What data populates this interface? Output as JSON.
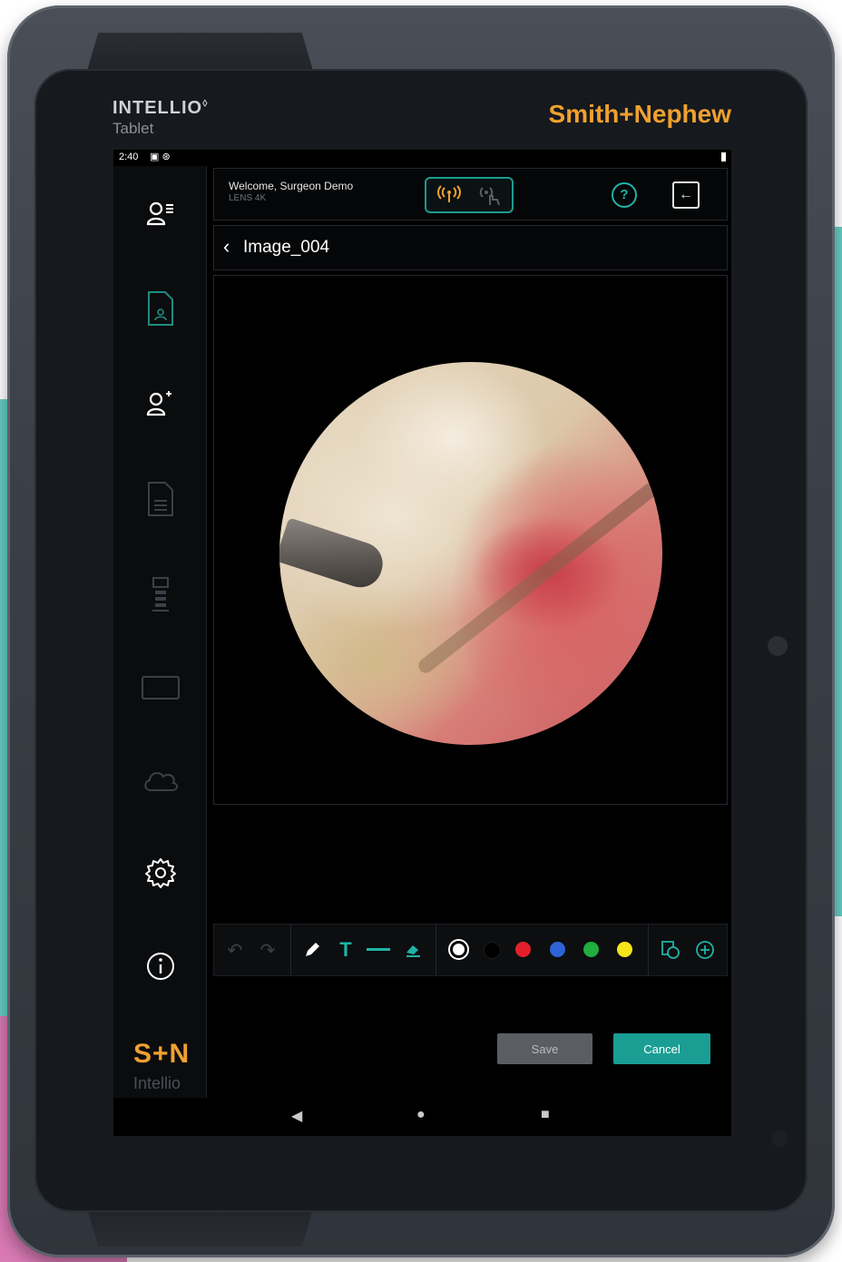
{
  "device": {
    "brand_product": "INTELLIO",
    "brand_product_mark": "◊",
    "brand_sub": "Tablet",
    "brand_company": "Smith+Nephew"
  },
  "status_bar": {
    "time": "2:40"
  },
  "sidebar": {
    "items": [
      {
        "name": "user-list",
        "icon": "user-list-icon",
        "state": "active"
      },
      {
        "name": "patient-file",
        "icon": "patient-file-icon",
        "state": "selected"
      },
      {
        "name": "add-user",
        "icon": "add-user-icon",
        "state": "active"
      },
      {
        "name": "document",
        "icon": "document-icon",
        "state": "disabled"
      },
      {
        "name": "tower",
        "icon": "tower-icon",
        "state": "disabled"
      },
      {
        "name": "display",
        "icon": "display-icon",
        "state": "disabled"
      },
      {
        "name": "cloud",
        "icon": "cloud-icon",
        "state": "disabled"
      },
      {
        "name": "settings",
        "icon": "gear-icon",
        "state": "active"
      },
      {
        "name": "info",
        "icon": "info-icon",
        "state": "active"
      }
    ],
    "logo": "S+N",
    "logo_sub": "Intellio"
  },
  "header": {
    "welcome": "Welcome, Surgeon Demo",
    "device_name": "LENS 4K",
    "help_label": "?",
    "colors": {
      "accent": "#1fb3a6",
      "signal": "#f0a030"
    }
  },
  "image_view": {
    "title": "Image_004"
  },
  "annotation_toolbar": {
    "tools": [
      "undo-icon",
      "redo-icon",
      "pencil-icon",
      "text-icon",
      "line-icon",
      "eraser-icon"
    ],
    "text_tool_label": "T",
    "colors": [
      {
        "name": "white",
        "hex": "#ffffff",
        "selected": true
      },
      {
        "name": "black",
        "hex": "#000000",
        "selected": false
      },
      {
        "name": "red",
        "hex": "#e3202a",
        "selected": false
      },
      {
        "name": "blue",
        "hex": "#2d63d6",
        "selected": false
      },
      {
        "name": "green",
        "hex": "#1fae3f",
        "selected": false
      },
      {
        "name": "yellow",
        "hex": "#f5e51a",
        "selected": false
      }
    ],
    "extra_tools": [
      "copy-icon",
      "add-icon"
    ]
  },
  "actions": {
    "save_label": "Save",
    "cancel_label": "Cancel"
  },
  "nav_bar": {
    "back": "◀",
    "home": "●",
    "recents": "■"
  }
}
